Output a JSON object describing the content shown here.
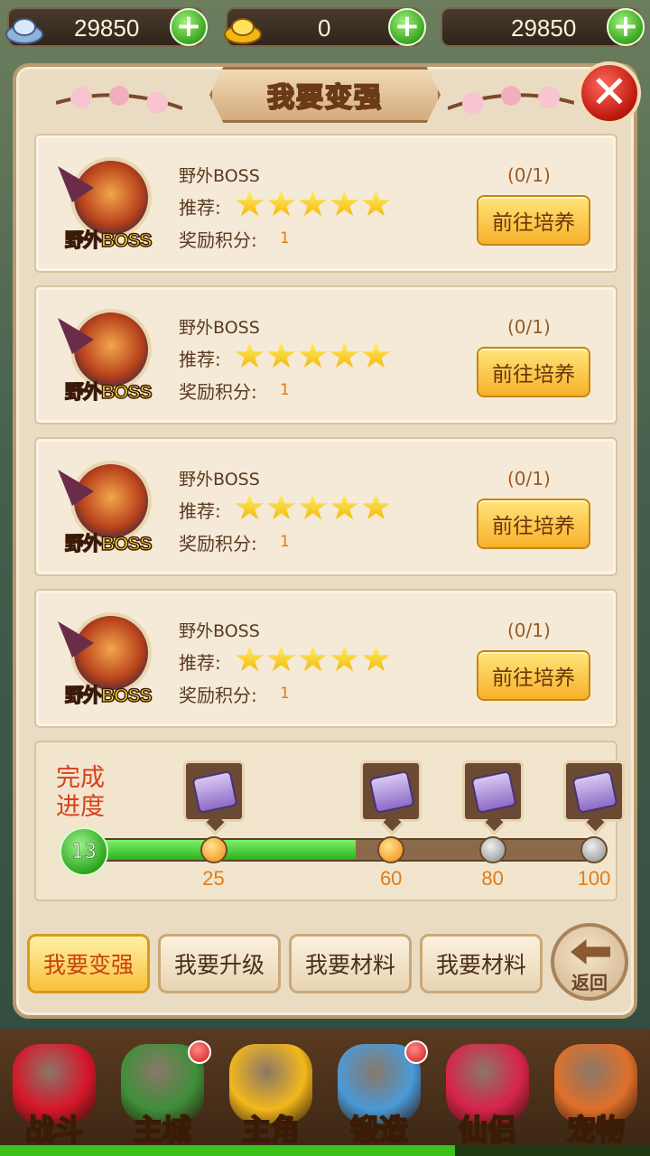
{
  "currency": {
    "silver": "29850",
    "gold": "0",
    "third": "29850",
    "icons": [
      "silver-ingot-icon",
      "gold-ingot-icon"
    ],
    "plus_icon": "plus-icon"
  },
  "panel": {
    "title": "我要变强",
    "close_icon": "close-icon"
  },
  "cards": [
    {
      "title": "野外BOSS",
      "tag": "野外BOSS",
      "rec_label": "推荐:",
      "stars": 5,
      "reward_label": "奖励积分:",
      "reward_value": "1",
      "progress": "(0/1)",
      "button": "前往培养"
    },
    {
      "title": "野外BOSS",
      "tag": "野外BOSS",
      "rec_label": "推荐:",
      "stars": 5,
      "reward_label": "奖励积分:",
      "reward_value": "1",
      "progress": "(0/1)",
      "button": "前往培养"
    },
    {
      "title": "野外BOSS",
      "tag": "野外BOSS",
      "rec_label": "推荐:",
      "stars": 5,
      "reward_label": "奖励积分:",
      "reward_value": "1",
      "progress": "(0/1)",
      "button": "前往培养"
    },
    {
      "title": "野外BOSS",
      "tag": "野外BOSS",
      "rec_label": "推荐:",
      "stars": 5,
      "reward_label": "奖励积分:",
      "reward_value": "1",
      "progress": "(0/1)",
      "button": "前往培养"
    }
  ],
  "progress": {
    "label": "完成进度",
    "current": "13",
    "max": 100,
    "milestones": [
      "25",
      "60",
      "80",
      "100"
    ],
    "milestone_reached": [
      true,
      true,
      false,
      false
    ],
    "fill_fraction": 0.53
  },
  "tabs": [
    "我要变强",
    "我要升级",
    "我要材料",
    "我要材料"
  ],
  "active_tab": 0,
  "back_label": "返回",
  "nav": [
    {
      "label": "战斗",
      "icon": "red-fighter-icon",
      "badge": false
    },
    {
      "label": "主城",
      "icon": "city-gate-icon",
      "badge": true
    },
    {
      "label": "主角",
      "icon": "hero-face-icon",
      "badge": false
    },
    {
      "label": "锻造",
      "icon": "hammer-icon",
      "badge": true
    },
    {
      "label": "仙侣",
      "icon": "heart-icon",
      "badge": false
    },
    {
      "label": "宠物",
      "icon": "monkey-pet-icon",
      "badge": false
    }
  ],
  "colors": {
    "accent_green": "#3bc11a",
    "button_gold": "#f7b12a",
    "label_red": "#d8401c"
  },
  "exp_fraction": 0.7
}
